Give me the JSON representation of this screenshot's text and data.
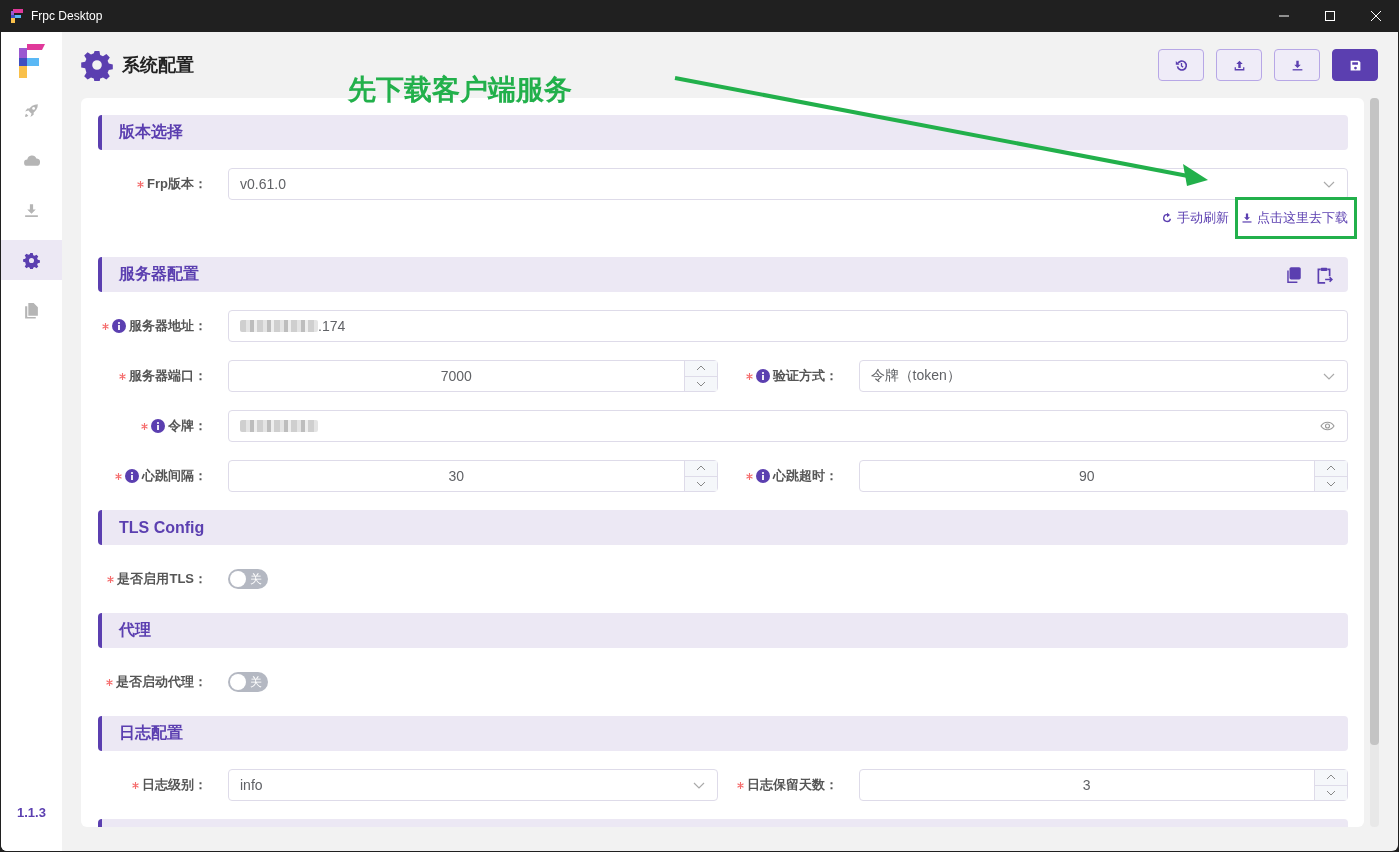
{
  "window": {
    "title": "Frpc Desktop"
  },
  "sidebar": {
    "items": [
      {
        "kind": "rocket",
        "selected": false
      },
      {
        "kind": "cloud",
        "selected": false
      },
      {
        "kind": "download",
        "selected": false
      },
      {
        "kind": "gear",
        "selected": true
      },
      {
        "kind": "file",
        "selected": false
      }
    ],
    "version": "1.1.3"
  },
  "header": {
    "title": "系统配置",
    "buttons": [
      {
        "kind": "history",
        "primary": false
      },
      {
        "kind": "upload",
        "primary": false
      },
      {
        "kind": "download",
        "primary": false
      },
      {
        "kind": "save",
        "primary": true
      }
    ]
  },
  "annotation": {
    "text": "先下载客户端服务"
  },
  "sections": [
    {
      "title": "版本选择",
      "rows": [
        [
          {
            "label": "Frp版本：",
            "required": true,
            "info": false,
            "kind": "select",
            "value": "v0.61.0"
          }
        ]
      ],
      "links": [
        {
          "kind": "refresh",
          "label": "手动刷新",
          "highlighted": false
        },
        {
          "kind": "download",
          "label": "点击这里去下载",
          "highlighted": true
        }
      ]
    },
    {
      "title": "服务器配置",
      "actions": [
        {
          "kind": "copy"
        },
        {
          "kind": "paste"
        }
      ],
      "rows": [
        [
          {
            "label": "服务器地址：",
            "required": true,
            "info": true,
            "kind": "text",
            "value": ".174",
            "redacted": true
          }
        ],
        [
          {
            "label": "服务器端口：",
            "required": true,
            "info": false,
            "kind": "number",
            "value": "7000"
          },
          {
            "label": "验证方式：",
            "required": true,
            "info": true,
            "kind": "select",
            "value": "令牌（token）"
          }
        ],
        [
          {
            "label": "令牌：",
            "required": true,
            "info": true,
            "kind": "password",
            "redacted": true
          }
        ],
        [
          {
            "label": "心跳间隔：",
            "required": true,
            "info": true,
            "kind": "number",
            "value": "30"
          },
          {
            "label": "心跳超时：",
            "required": true,
            "info": true,
            "kind": "number",
            "value": "90"
          }
        ]
      ]
    },
    {
      "title": "TLS Config",
      "rows": [
        [
          {
            "label": "是否启用TLS：",
            "required": true,
            "info": false,
            "kind": "switch",
            "on": false,
            "state_text": "关"
          }
        ]
      ]
    },
    {
      "title": "代理",
      "rows": [
        [
          {
            "label": "是否启动代理：",
            "required": true,
            "info": false,
            "kind": "switch",
            "on": false,
            "state_text": "关"
          }
        ]
      ]
    },
    {
      "title": "日志配置",
      "rows": [
        [
          {
            "label": "日志级别：",
            "required": true,
            "info": false,
            "kind": "select",
            "value": "info"
          },
          {
            "label": "日志保留天数：",
            "required": true,
            "info": false,
            "kind": "number",
            "value": "3"
          }
        ]
      ]
    },
    {
      "partial": true
    }
  ]
}
